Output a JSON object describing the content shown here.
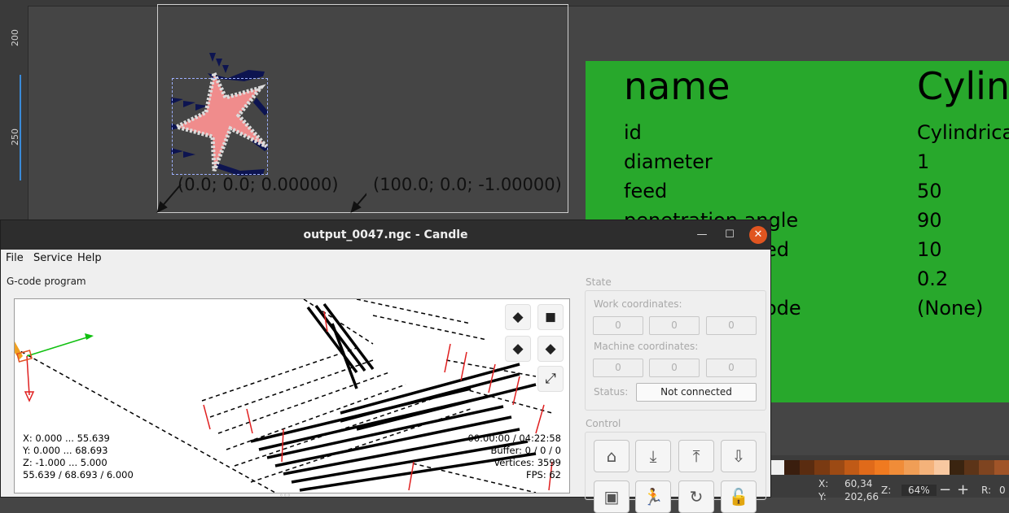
{
  "inkscape": {
    "ruler_labels": [
      "200",
      "250"
    ],
    "coord_left": "(0.0; 0.0; 0.00000)",
    "coord_right": "(100.0; 0.0; -1.00000)",
    "zoom": "64%",
    "cursor_x_label": "X:",
    "cursor_x": "60,34",
    "cursor_y_label": "Y:",
    "cursor_y": "202,66",
    "z_label": "Z:",
    "r_label": "R:",
    "r_value": "0",
    "palette": [
      "#f0f0f0",
      "#3a1e0e",
      "#5a2c10",
      "#7a3a12",
      "#9c4a14",
      "#c05a16",
      "#e06a1a",
      "#f07a20",
      "#f08c38",
      "#f09e56",
      "#f4b27a",
      "#f8c8a0",
      "#3a2410",
      "#5c3418",
      "#7e4420",
      "#a05428"
    ]
  },
  "param_table": {
    "header_name": "name",
    "header_value": "Cylin",
    "rows": [
      {
        "name": "id",
        "value": "Cylindrica"
      },
      {
        "name": "diameter",
        "value": "1"
      },
      {
        "name": "feed",
        "value": "50"
      },
      {
        "name": "penetration angle",
        "value": "90"
      },
      {
        "name": "",
        "value": "10"
      },
      {
        "name": "",
        "value": "0.2"
      },
      {
        "name": "",
        "value": "(None)"
      }
    ],
    "partial_fragments": [
      "ed",
      "ode"
    ]
  },
  "candle": {
    "title": "output_0047.ngc - Candle",
    "menu": [
      "File",
      "Service",
      "Help"
    ],
    "gcode_label": "G-code program",
    "viewport_info_left": [
      "X: 0.000 ... 55.639",
      "Y: 0.000 ... 68.693",
      "Z: -1.000 ... 5.000",
      "55.639 / 68.693 / 6.000"
    ],
    "viewport_info_right": [
      "00:00:00 / 04:22:58",
      "Buffer: 0 / 0 / 0",
      "Vertices: 3599",
      "FPS: 62"
    ],
    "state": {
      "label": "State",
      "work_label": "Work coordinates:",
      "work": [
        "0",
        "0",
        "0"
      ],
      "machine_label": "Machine coordinates:",
      "machine": [
        "0",
        "0",
        "0"
      ],
      "status_label": "Status:",
      "status_value": "Not connected"
    },
    "control_label": "Control"
  }
}
